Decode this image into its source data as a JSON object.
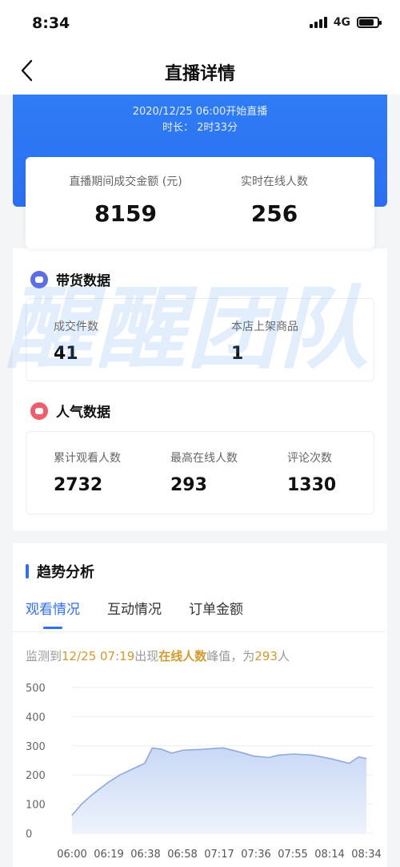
{
  "statusbar": {
    "time": "8:34",
    "network": "4G"
  },
  "nav": {
    "title": "直播详情"
  },
  "banner": {
    "start": "2020/12/25 06:00开始直播",
    "duration": "时长：  2时33分"
  },
  "summary": [
    {
      "label": "直播期间成交金额 (元)",
      "value": "8159"
    },
    {
      "label": "实时在线人数",
      "value": "256"
    }
  ],
  "goods": {
    "title": "带货数据",
    "items": [
      {
        "label": "成交件数",
        "value": "41"
      },
      {
        "label": "本店上架商品",
        "value": "1"
      }
    ]
  },
  "popularity": {
    "title": "人气数据",
    "items": [
      {
        "label": "累计观看人数",
        "value": "2732"
      },
      {
        "label": "最高在线人数",
        "value": "293"
      },
      {
        "label": "评论次数",
        "value": "1330"
      }
    ]
  },
  "watermark": "醒醒团队",
  "trend": {
    "title": "趋势分析",
    "tabs": [
      {
        "label": "观看情况",
        "active": true
      },
      {
        "label": "互动情况",
        "active": false
      },
      {
        "label": "订单金额",
        "active": false
      }
    ],
    "peak": {
      "prefix": "监测到",
      "time": "12/25 07:19",
      "mid": "出现",
      "metric": "在线人数",
      "mid2": "峰值，为",
      "value": "293",
      "suffix": "人"
    }
  },
  "colors": {
    "primary": "#2f6ff3",
    "highlight": "#d39a2c",
    "goods_icon": "#5b6ee8",
    "popularity_icon": "#ef5d6b"
  },
  "icons": {
    "back": "chevron-left-icon",
    "goods": "goods-data-icon",
    "popularity": "popularity-data-icon"
  },
  "chart_data": {
    "type": "area",
    "x_ticks": [
      "06:00",
      "06:19",
      "06:38",
      "06:58",
      "07:17",
      "07:36",
      "07:55",
      "08:14",
      "08:34"
    ],
    "y_ticks": [
      0,
      100,
      200,
      300,
      400,
      500
    ],
    "ylim": [
      0,
      500
    ],
    "x_minutes": [
      0,
      5,
      10,
      19,
      25,
      33,
      38,
      42,
      47,
      52,
      58,
      68,
      79,
      87,
      95,
      103,
      108,
      116,
      126,
      136,
      145,
      150,
      154
    ],
    "values": [
      62,
      100,
      130,
      175,
      200,
      225,
      240,
      293,
      288,
      275,
      285,
      288,
      293,
      280,
      265,
      260,
      268,
      272,
      268,
      255,
      240,
      262,
      256
    ]
  }
}
